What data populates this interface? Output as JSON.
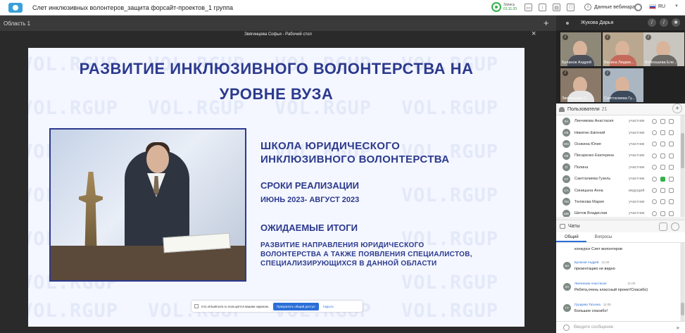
{
  "app": {
    "title": "Слет инклюзивных волонтеров_защита форсайт-проектов_1 группа",
    "record": {
      "label": "Запись",
      "time": "01:11:33"
    },
    "webinar_label": "Данные вебинара",
    "language": "RU"
  },
  "area": {
    "label": "Область 1",
    "add": "+"
  },
  "screen": {
    "title": "Звягинцева Софья - Рабочий стол",
    "close": "×"
  },
  "slide": {
    "watermark": "VOL.RGUP",
    "title_line1": "РАЗВИТИЕ ИНКЛЮЗИВНОГО ВОЛОНТЕРСТВА НА",
    "title_line2": "УРОВНЕ ВУЗА",
    "school_line1": "ШКОЛА ЮРИДИЧЕСКОГО",
    "school_line2": "ИНКЛЮЗИВНОГО ВОЛОНТЕРСТВА",
    "terms_title": "СРОКИ РЕАЛИЗАЦИИ",
    "terms_value": "ИЮНЬ 2023- АВГУСТ 2023",
    "results_title": "ОЖИДАЕМЫЕ ИТОГИ",
    "results_line1": "РАЗВИТИЕ НАПРАВЛЕНИЯ ЮРИДИЧЕСКОГО",
    "results_line2": "ВОЛОНТЕРСТВА А ТАКЖЕ ПОЯВЛЕНИЯ СПЕЦИАЛИСТОВ,",
    "results_line3": "СПЕЦИАЛИЗИРУЮЩИХСЯ В ДАННОЙ ОБЛАСТИ"
  },
  "sharebar": {
    "text": "mr1.virtualroom.ru пользуется вашим экраном.",
    "stop": "Прекратить общий доступ",
    "hide": "Скрыть"
  },
  "video": {
    "header_name": "Жукова Дарья",
    "tiles": [
      {
        "name": "Буланов Андрей"
      },
      {
        "name": "Васина Людми..."
      },
      {
        "name": "Войлошева Еле..."
      },
      {
        "name": "Звягинцева С..."
      },
      {
        "name": "Саитгалиева Гу..."
      }
    ]
  },
  "users": {
    "label": "Пользователи",
    "count": "21",
    "list": [
      {
        "initials": "ЛА",
        "name": "Линчикова Анастасия",
        "role": "участник"
      },
      {
        "initials": "НЕ",
        "name": "Никитин Евгений",
        "role": "участник"
      },
      {
        "initials": "ОЮ",
        "name": "Осикина Юлия",
        "role": "участник"
      },
      {
        "initials": "ПЕ",
        "name": "Писаренко Екатерина",
        "role": "участник"
      },
      {
        "initials": "П",
        "name": "Полина",
        "role": "участник"
      },
      {
        "initials": "СГ",
        "name": "Саитгалиева Гузель",
        "role": "участник"
      },
      {
        "initials": "СА",
        "name": "Синицына Анна",
        "role": "ведущий"
      },
      {
        "initials": "ТМ",
        "name": "Телякова Мария",
        "role": "участник"
      },
      {
        "initials": "ШВ",
        "name": "Шитов Владислав",
        "role": "участник"
      }
    ]
  },
  "chats": {
    "label": "Чаты",
    "tabs": [
      "Общий",
      "Вопросы"
    ],
    "messages": [
      {
        "initials": "",
        "name": "",
        "time": "",
        "text": "конкурсе Слет волонтеров"
      },
      {
        "initials": "БА",
        "name": "Буланов Андрей",
        "time": "11:02",
        "text": "презентацию не видно"
      },
      {
        "initials": "ЛА",
        "name": "Линчикова Анастасия",
        "time": "11:05",
        "text": "Ребята,очень классный проект!Спасибо)"
      },
      {
        "initials": "ГТ",
        "name": "Груздева Татьяна",
        "time": "11:05",
        "text": "Большое спасибо!"
      }
    ],
    "input_placeholder": "Введите сообщение"
  }
}
